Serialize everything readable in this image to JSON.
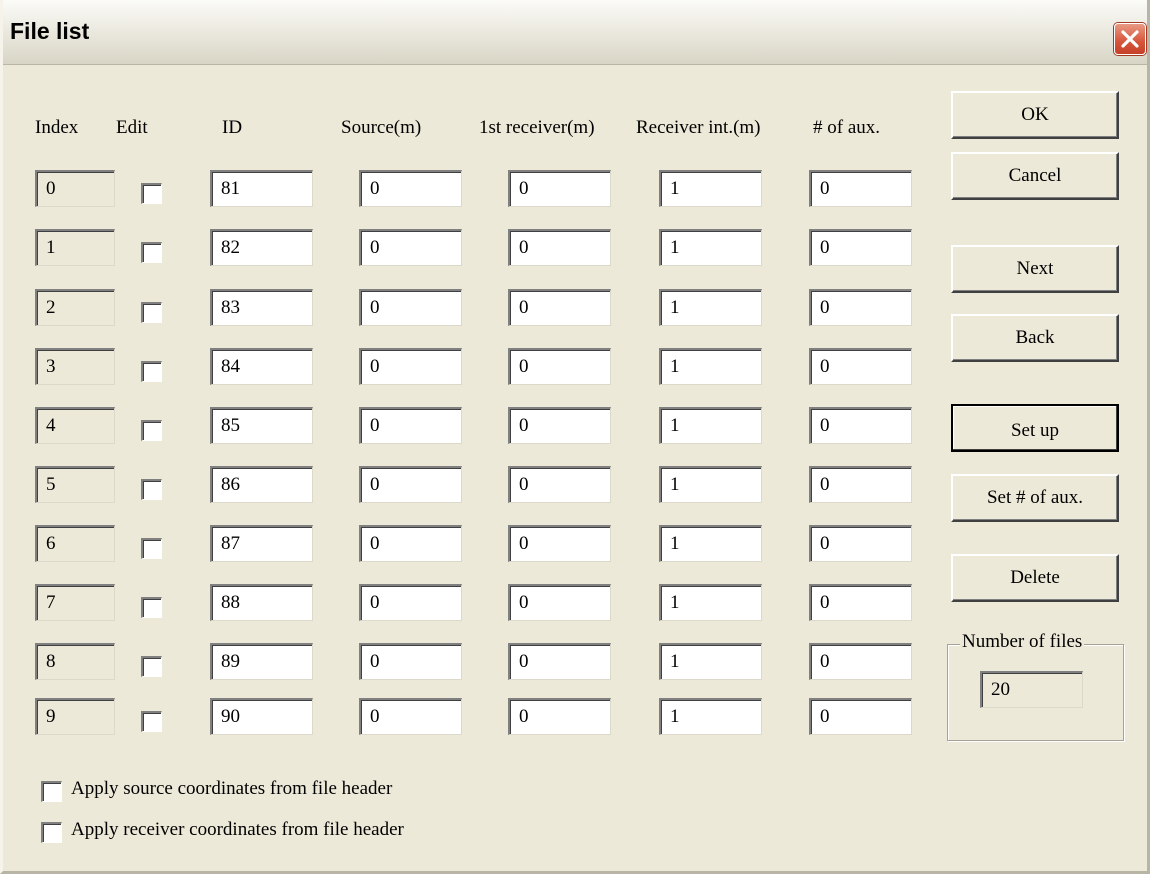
{
  "window": {
    "title": "File list"
  },
  "headers": {
    "index": "Index",
    "edit": "Edit",
    "id": "ID",
    "source": "Source(m)",
    "first_receiver": "1st receiver(m)",
    "receiver_int": "Receiver int.(m)",
    "aux": "# of aux."
  },
  "rows": [
    {
      "index": "0",
      "id": "81",
      "source": "0",
      "first_receiver": "0",
      "receiver_int": "1",
      "aux": "0"
    },
    {
      "index": "1",
      "id": "82",
      "source": "0",
      "first_receiver": "0",
      "receiver_int": "1",
      "aux": "0"
    },
    {
      "index": "2",
      "id": "83",
      "source": "0",
      "first_receiver": "0",
      "receiver_int": "1",
      "aux": "0"
    },
    {
      "index": "3",
      "id": "84",
      "source": "0",
      "first_receiver": "0",
      "receiver_int": "1",
      "aux": "0"
    },
    {
      "index": "4",
      "id": "85",
      "source": "0",
      "first_receiver": "0",
      "receiver_int": "1",
      "aux": "0"
    },
    {
      "index": "5",
      "id": "86",
      "source": "0",
      "first_receiver": "0",
      "receiver_int": "1",
      "aux": "0"
    },
    {
      "index": "6",
      "id": "87",
      "source": "0",
      "first_receiver": "0",
      "receiver_int": "1",
      "aux": "0"
    },
    {
      "index": "7",
      "id": "88",
      "source": "0",
      "first_receiver": "0",
      "receiver_int": "1",
      "aux": "0"
    },
    {
      "index": "8",
      "id": "89",
      "source": "0",
      "first_receiver": "0",
      "receiver_int": "1",
      "aux": "0"
    },
    {
      "index": "9",
      "id": "90",
      "source": "0",
      "first_receiver": "0",
      "receiver_int": "1",
      "aux": "0"
    }
  ],
  "buttons": {
    "ok": "OK",
    "cancel": "Cancel",
    "next": "Next",
    "back": "Back",
    "setup": "Set up",
    "set_aux": "Set # of aux.",
    "delete": "Delete"
  },
  "number_of_files": {
    "label": "Number of files",
    "value": "20"
  },
  "options": {
    "apply_source": "Apply source coordinates from file header",
    "apply_receiver": "Apply receiver coordinates from file header"
  },
  "icons": {
    "close": "close-icon"
  },
  "colors": {
    "dialog_bg": "#ece9d8",
    "close_button": "#d6553a"
  }
}
